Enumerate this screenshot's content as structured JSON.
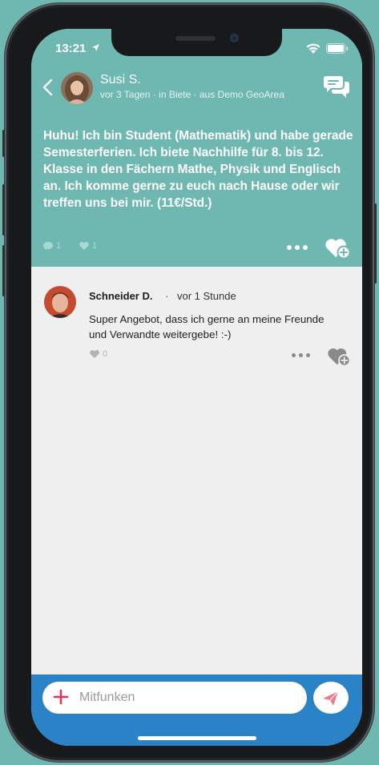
{
  "colors": {
    "background": "#6fb8b1",
    "post_header": "#6fb8b1",
    "composer_bar": "#2983c6",
    "plus_accent": "#e0355c",
    "send_accent": "#f07a8c"
  },
  "status_bar": {
    "time": "13:21",
    "icons": [
      "location-arrow-icon",
      "wifi-icon",
      "battery-icon"
    ]
  },
  "post": {
    "author": "Susi S.",
    "meta": "vor 3 Tagen · in Biete · aus Demo GeoArea",
    "text": "Huhu! Ich bin Student (Mathematik) und habe gerade Semesterferien. Ich biete Nachhilfe für 8. bis 12. Klasse in den Fächern Mathe, Physik und Englisch an. Ich komme gerne zu euch nach Hause oder wir treffen uns bei mir. (11€/Std.)",
    "comment_count": "1",
    "like_count": "1"
  },
  "comments": [
    {
      "author": "Schneider D.",
      "separator": "·",
      "time": "vor 1 Stunde",
      "text": "Super Angebot, dass ich gerne an meine Freunde und Verwandte weitergebe! :-)",
      "like_count": "0"
    }
  ],
  "composer": {
    "placeholder": "Mitfunken"
  }
}
